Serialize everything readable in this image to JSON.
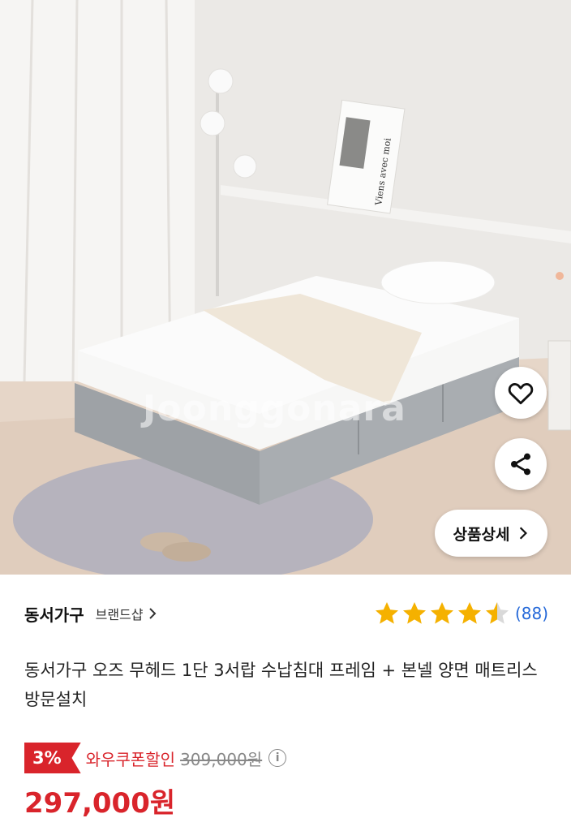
{
  "image": {
    "watermark": "Joonggonara",
    "poster_text": "Viens avec moi",
    "detail_button_label": "상품상세"
  },
  "product": {
    "brand": "동서가구",
    "brand_shop_label": "브랜드샵",
    "rating_stars": 4.5,
    "review_count": "(88)",
    "title": "동서가구 오즈 무헤드 1단 3서랍 수납침대 프레임 + 본넬 양면 매트리스 방문설치",
    "discount_badge": "3%",
    "coupon_label": "와우쿠폰할인",
    "original_price": "309,000원",
    "final_price": "297,000원"
  },
  "colors": {
    "accent_red": "#d9242b",
    "star_gold": "#f5b100",
    "link_blue": "#2468d8"
  },
  "icons": [
    "heart-icon",
    "share-icon",
    "chevron-right-icon",
    "star-icon",
    "info-icon"
  ]
}
